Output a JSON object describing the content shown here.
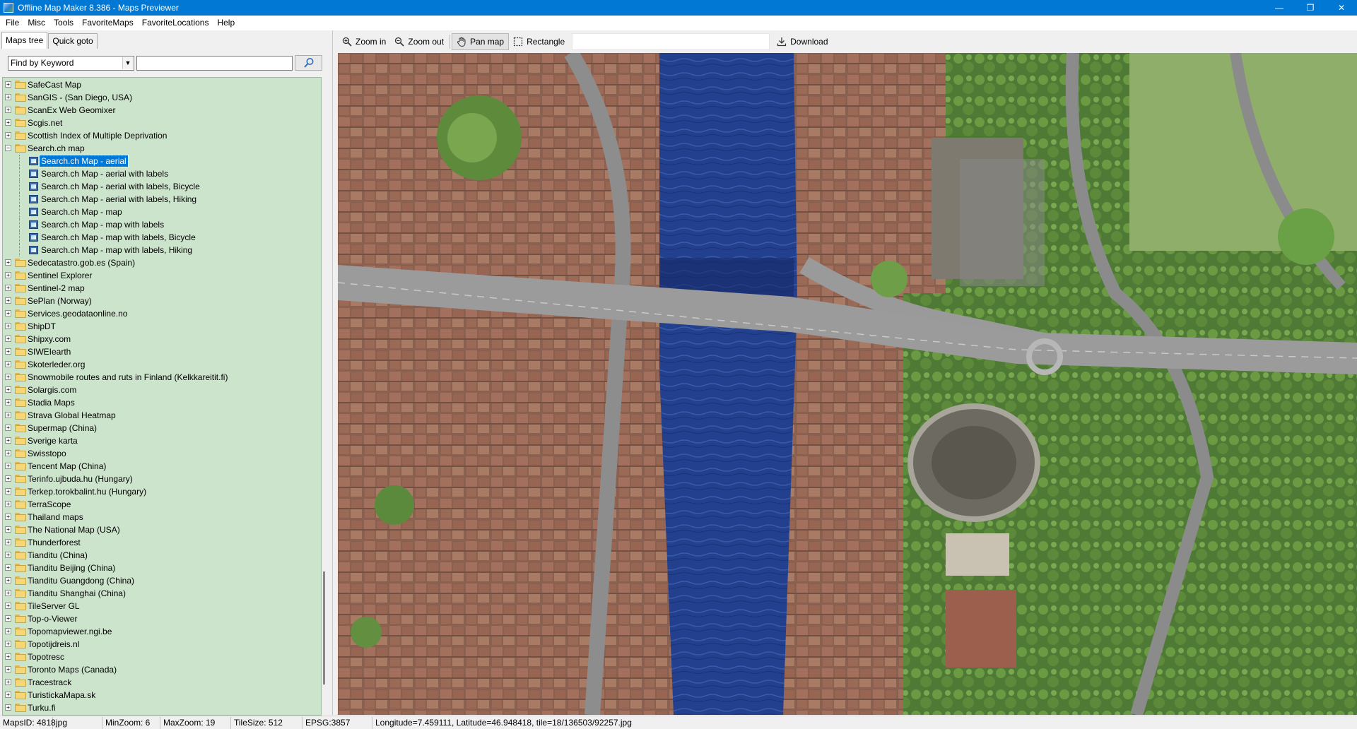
{
  "window": {
    "title": "Offline Map Maker 8.386 - Maps Previewer",
    "minimize": "—",
    "maximize": "❐",
    "close": "✕"
  },
  "menu": [
    "File",
    "Misc",
    "Tools",
    "FavoriteMaps",
    "FavoriteLocations",
    "Help"
  ],
  "left": {
    "tabs": [
      "Maps tree",
      "Quick goto"
    ],
    "find_mode": "Find by Keyword",
    "search_value": "",
    "search_icon": "search-icon"
  },
  "tree": {
    "before": [
      "SafeCast Map",
      "SanGIS - (San Diego, USA)",
      "ScanEx Web Geomixer",
      "Scgis.net",
      "Scottish Index of Multiple Deprivation"
    ],
    "open_folder": "Search.ch map",
    "children": [
      "Search.ch Map - aerial",
      "Search.ch Map - aerial with labels",
      "Search.ch Map - aerial with labels, Bicycle",
      "Search.ch Map - aerial with labels, Hiking",
      "Search.ch Map - map",
      "Search.ch Map - map with labels",
      "Search.ch Map - map with labels, Bicycle",
      "Search.ch Map - map with labels, Hiking"
    ],
    "selected_child": 0,
    "after": [
      "Sedecatastro.gob.es (Spain)",
      "Sentinel Explorer",
      "Sentinel-2 map",
      "SePlan (Norway)",
      "Services.geodataonline.no",
      "ShipDT",
      "Shipxy.com",
      "SIWEIearth",
      "Skoterleder.org",
      "Snowmobile routes and ruts in Finland (Kelkkareitit.fi)",
      "Solargis.com",
      "Stadia Maps",
      "Strava Global Heatmap",
      "Supermap (China)",
      "Sverige karta",
      "Swisstopo",
      "Tencent Map (China)",
      "Terinfo.ujbuda.hu (Hungary)",
      "Terkep.torokbalint.hu (Hungary)",
      "TerraScope",
      "Thailand maps",
      "The National Map (USA)",
      "Thunderforest",
      "Tianditu (China)",
      "Tianditu Beijing (China)",
      "Tianditu Guangdong (China)",
      "Tianditu Shanghai (China)",
      "TileServer GL",
      "Top-o-Viewer",
      "Topomapviewer.ngi.be",
      "Topotijdreis.nl",
      "Topotresc",
      "Toronto Maps (Canada)",
      "Tracestrack",
      "TuristickaMapa.sk",
      "Turku.fi"
    ]
  },
  "toolbar": {
    "zoom_in": "Zoom in",
    "zoom_out": "Zoom out",
    "pan_map": "Pan map",
    "rectangle": "Rectangle",
    "download": "Download",
    "active_tool": "pan_map"
  },
  "status": {
    "maps_id": "MapsID: 4818",
    "format": "jpg",
    "min_zoom": "MinZoom: 6",
    "max_zoom": "MaxZoom: 19",
    "tile_size": "TileSize: 512",
    "epsg": "EPSG:3857",
    "location": "Longitude=7.459111, Latitude=46.948418, tile=18/136503/92257.jpg"
  },
  "colors": {
    "titlebar": "#0078d4",
    "tree_bg": "#cce3cc",
    "selection": "#0078d7",
    "river": "#1f3a8a"
  }
}
